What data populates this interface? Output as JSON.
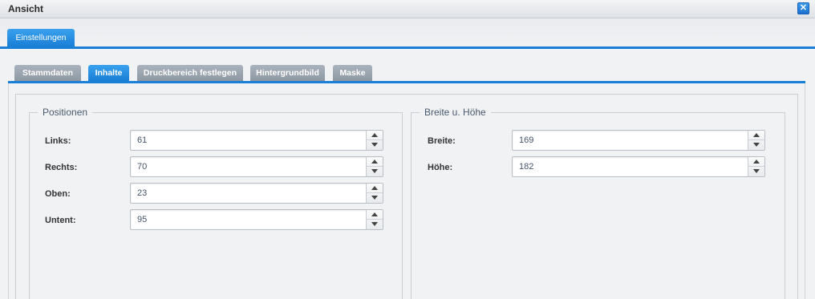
{
  "window": {
    "title": "Ansicht",
    "close_label": "✕"
  },
  "outer_tabs": [
    {
      "label": "Einstellungen",
      "active": true
    }
  ],
  "inner_tabs": [
    {
      "label": "Stammdaten",
      "active": false
    },
    {
      "label": "Inhalte",
      "active": true
    },
    {
      "label": "Druckbereich festlegen",
      "active": false
    },
    {
      "label": "Hintergrundbild",
      "active": false
    },
    {
      "label": "Maske",
      "active": false
    }
  ],
  "positionen": {
    "legend": "Positionen",
    "fields": [
      {
        "label": "Links:",
        "value": "61"
      },
      {
        "label": "Rechts:",
        "value": "70"
      },
      {
        "label": "Oben:",
        "value": "23"
      },
      {
        "label": "Untent:",
        "value": "95"
      }
    ]
  },
  "breite_hoehe": {
    "legend": "Breite u. Höhe",
    "fields": [
      {
        "label": "Breite:",
        "value": "169"
      },
      {
        "label": "Höhe:",
        "value": "182"
      }
    ]
  },
  "colors": {
    "accent": "#1a7fd6",
    "inactive_tab": "#9aa3ad",
    "background": "#f1f2f4"
  }
}
